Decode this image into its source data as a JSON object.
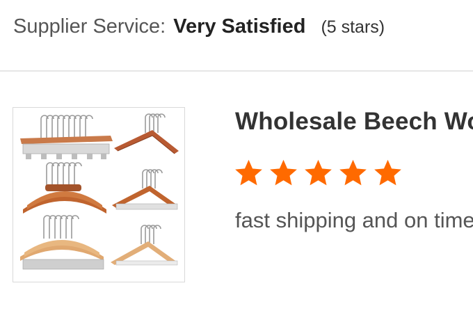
{
  "supplier_service": {
    "label": "Supplier Service:",
    "value": "Very Satisfied",
    "stars_text": "(5 stars)"
  },
  "review": {
    "product_title": "Wholesale Beech Wooden Hangers",
    "rating": 5,
    "rating_max": 5,
    "star_color": "#ff6a00",
    "comment": "fast shipping and on time delivery",
    "thumbnail_icon": "wooden-hangers-product-image"
  }
}
